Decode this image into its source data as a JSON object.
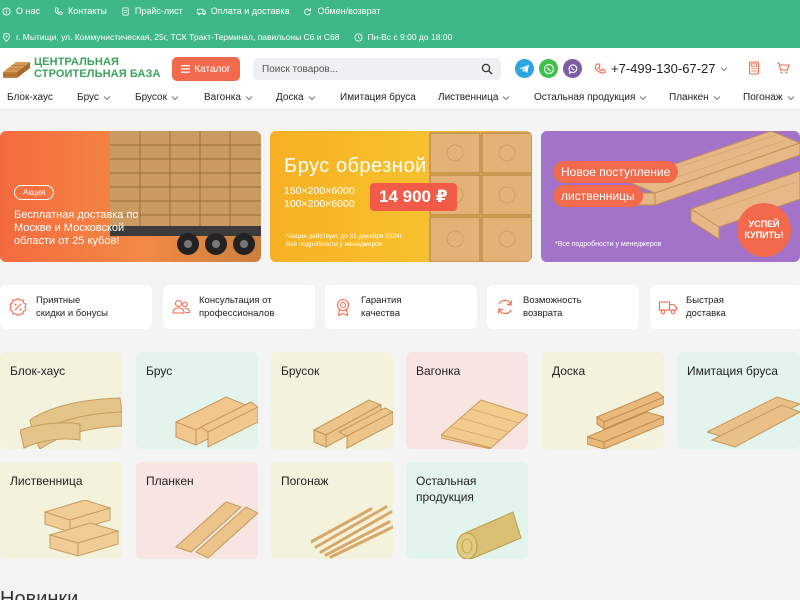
{
  "topbar": {
    "links": [
      "О нас",
      "Контакты",
      "Прайс-лист",
      "Оплата и доставка",
      "Обмен/возврат"
    ],
    "address": "г. Мытищи, ул. Коммунистическая, 25г, ТСК Тракт-Терминал, павильоны С6 и С68",
    "hours": "Пн-Вс с 9:00 до 18:00"
  },
  "header": {
    "logo_line1": "ЦЕНТРАЛЬНАЯ",
    "logo_line2": "СТРОИТЕЛЬНАЯ БАЗА",
    "catalog_label": "Каталог",
    "search_placeholder": "Поиск товаров...",
    "phone": "+7-499-130-67-27"
  },
  "nav": [
    "Блок-хаус",
    "Брус",
    "Брусок",
    "Вагонка",
    "Доска",
    "Имитация бруса",
    "Лиственница",
    "Остальная продукция",
    "Планкен",
    "Погонаж"
  ],
  "banners": {
    "b1": {
      "badge": "Акция",
      "text": "Бесплатная доставка по Москве и Московской области от 25 кубов!"
    },
    "b2": {
      "title": "Брус обрезной",
      "size1": "150×200×6000",
      "size2": "100×200×6000",
      "price": "14 900 ₽",
      "note1": "*Акция действует до 31 декабря 2024г.",
      "note2": "Все подробности у менеджеров"
    },
    "b3": {
      "pill1": "Новое поступление",
      "pill2": "лиственницы",
      "note": "*Все подробности у менеджеров",
      "circle1": "УСПЕЙ",
      "circle2": "КУПИТЬ!"
    }
  },
  "features": [
    {
      "line1": "Приятные",
      "line2": "скидки и бонусы",
      "icon": "discount-icon"
    },
    {
      "line1": "Консультация от",
      "line2": "профессионалов",
      "icon": "users-icon"
    },
    {
      "line1": "Гарантия",
      "line2": "качества",
      "icon": "award-icon"
    },
    {
      "line1": "Возможность",
      "line2": "возврата",
      "icon": "refresh-icon"
    },
    {
      "line1": "Быстрая",
      "line2": "доставка",
      "icon": "truck-icon"
    }
  ],
  "categories": [
    {
      "label": "Блок-хаус",
      "bg": "#f3f2dd"
    },
    {
      "label": "Брус",
      "bg": "#e3f4ec"
    },
    {
      "label": "Брусок",
      "bg": "#f3f2dd"
    },
    {
      "label": "Вагонка",
      "bg": "#f8e4e0"
    },
    {
      "label": "Доска",
      "bg": "#f3f2dd"
    },
    {
      "label": "Имитация бруса",
      "bg": "#e3f4ec"
    },
    {
      "label": "Лиственница",
      "bg": "#f3f2dd"
    },
    {
      "label": "Планкен",
      "bg": "#f8e4e0"
    },
    {
      "label": "Погонаж",
      "bg": "#f3f2dd"
    },
    {
      "label_line1": "Остальная",
      "label_line2": "продукция",
      "bg": "#e3f4ec"
    }
  ],
  "section_title": "Новинки",
  "colors": {
    "green": "#3fb887",
    "orange": "#f26a4b",
    "logo_green": "#3aa35a"
  }
}
